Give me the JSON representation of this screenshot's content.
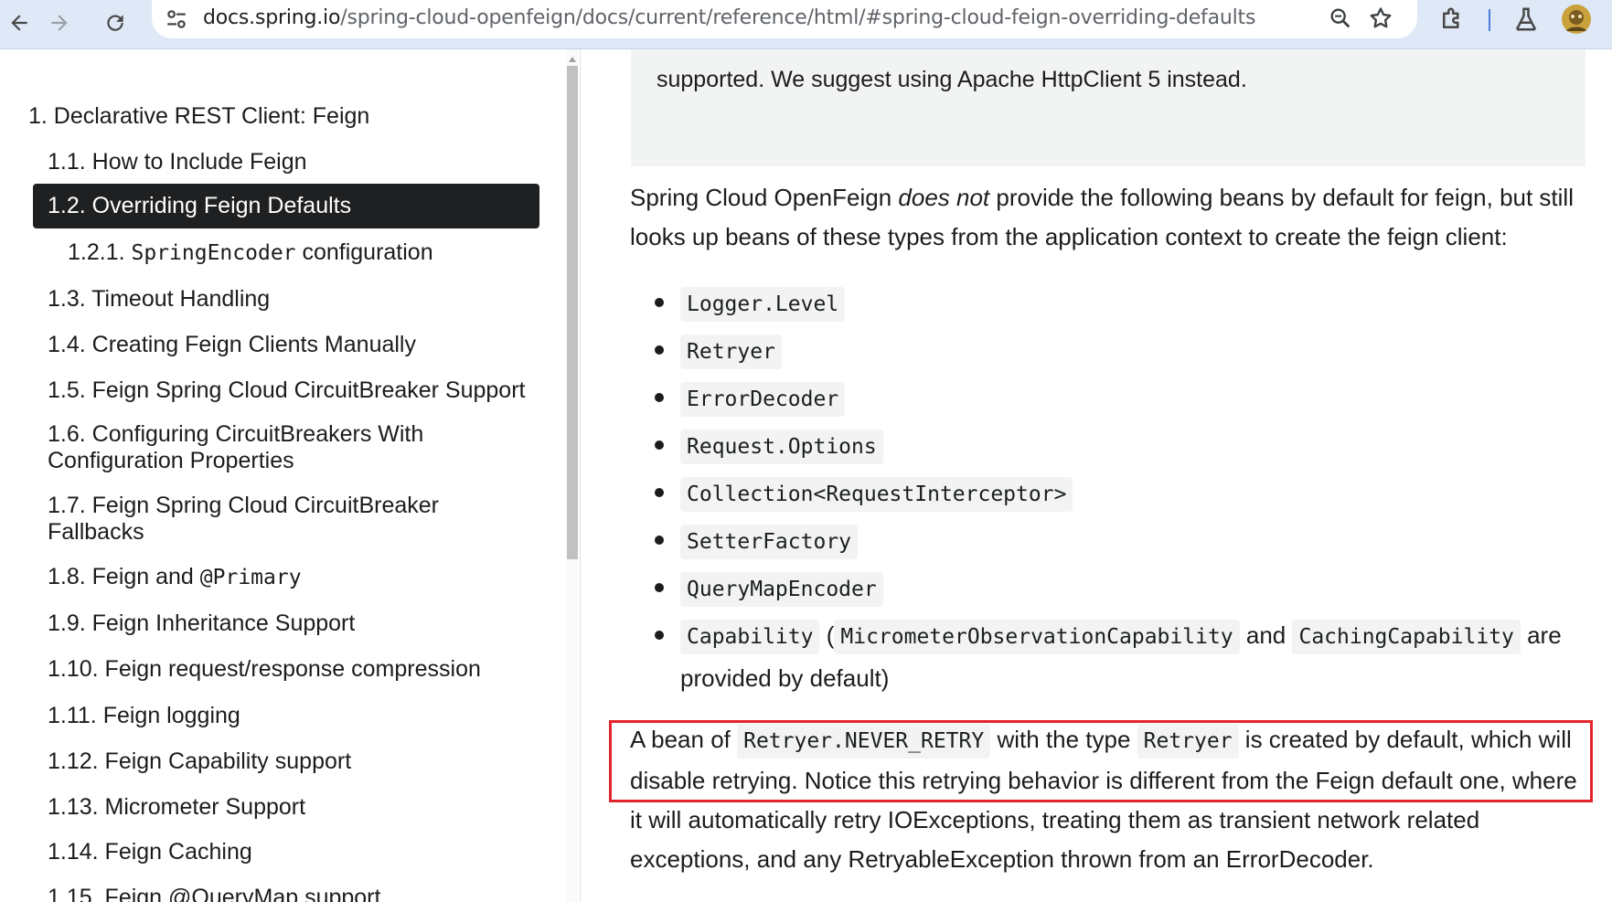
{
  "browser": {
    "url_host": "docs.spring.io",
    "url_path": "/spring-cloud-openfeign/docs/current/reference/html/#spring-cloud-feign-overriding-defaults",
    "icons": [
      "back-arrow-icon",
      "forward-arrow-icon",
      "reload-icon",
      "site-settings-icon",
      "zoom-icon",
      "bookmark-star-icon",
      "extensions-icon",
      "labs-flask-icon",
      "profile-avatar-icon"
    ]
  },
  "sidebar": {
    "items": [
      {
        "label": "1. Declarative REST Client: Feign"
      },
      {
        "label": "1.1. How to Include Feign"
      },
      {
        "label": "1.2. Overriding Feign Defaults",
        "active": true
      },
      {
        "label_prefix": "1.2.1. ",
        "label_code": "SpringEncoder",
        "label_suffix": " configuration"
      },
      {
        "label": "1.3. Timeout Handling"
      },
      {
        "label": "1.4. Creating Feign Clients Manually"
      },
      {
        "label": "1.5. Feign Spring Cloud CircuitBreaker Support"
      },
      {
        "label": "1.6. Configuring CircuitBreakers With Configuration Properties"
      },
      {
        "label": "1.7. Feign Spring Cloud CircuitBreaker Fallbacks"
      },
      {
        "label_prefix": "1.8. Feign and ",
        "label_code": "@Primary"
      },
      {
        "label": "1.9. Feign Inheritance Support"
      },
      {
        "label": "1.10. Feign request/response compression"
      },
      {
        "label": "1.11. Feign logging"
      },
      {
        "label": "1.12. Feign Capability support"
      },
      {
        "label": "1.13. Micrometer Support"
      },
      {
        "label": "1.14. Feign Caching"
      },
      {
        "label": "1.15. Feign @QueryMap support"
      }
    ]
  },
  "content": {
    "note_text": "supported. We suggest using Apache HttpClient 5 instead.",
    "intro_before": "Spring Cloud OpenFeign ",
    "intro_em": "does not",
    "intro_after": " provide the following beans by default for feign, but still looks up beans of these types from the application context to create the feign client:",
    "beans": [
      "Logger.Level",
      "Retryer",
      "ErrorDecoder",
      "Request.Options",
      "Collection<RequestInterceptor>",
      "SetterFactory",
      "QueryMapEncoder"
    ],
    "capability": {
      "code1": "Capability",
      "open": " (",
      "code2": "MicrometerObservationCapability",
      "and": " and ",
      "code3": "CachingCapability",
      "tail": " are provided by default)"
    },
    "retry_para": {
      "t1": "A bean of ",
      "c1": "Retryer.NEVER_RETRY",
      "t2": " with the type ",
      "c2": "Retryer",
      "t3": " is created by default, which will disable retrying. Notice this retrying behavior is different from the Feign default one, where it will automatically retry IOExceptions, treating them as transient network related exceptions, and any RetryableException thrown from an ErrorDecoder."
    },
    "highlight_color": "#e3262c"
  }
}
